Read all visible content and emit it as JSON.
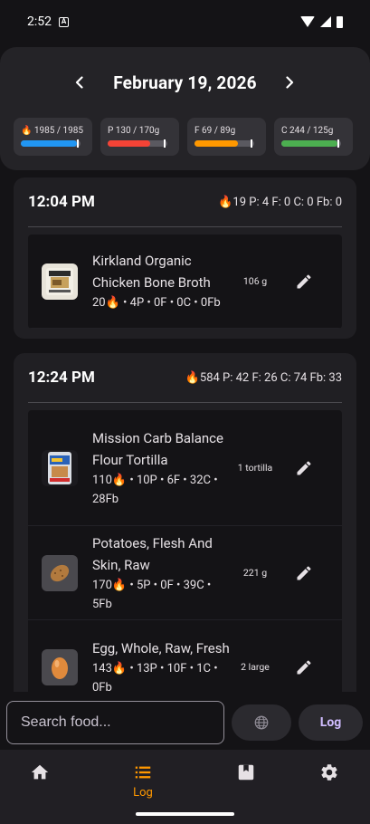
{
  "status_bar": {
    "time": "2:52",
    "notification_icon": "A"
  },
  "header": {
    "date": "February 19, 2026",
    "prev_icon": "chevron-left",
    "next_icon": "chevron-right",
    "macros": [
      {
        "label": "🔥 1985 / 1985",
        "fraction": 1.0,
        "color": "#2196f3"
      },
      {
        "label": "P 130 / 170g",
        "fraction": 0.76,
        "color": "#f44336"
      },
      {
        "label": "F 69 / 89g",
        "fraction": 0.78,
        "color": "#ff9800"
      },
      {
        "label": "C 244 / 125g",
        "fraction": 1.0,
        "color": "#4caf50"
      }
    ]
  },
  "meals": [
    {
      "time": "12:04 PM",
      "summary": "🔥19  P: 4  F: 0  C: 0  Fb: 0",
      "foods": [
        {
          "name": "Kirkland Organic Chicken Bone Broth",
          "macros": "20🔥 • 4P • 0F • 0C • 0Fb",
          "qty": "106 g",
          "icon": "product-photo"
        }
      ]
    },
    {
      "time": "12:24 PM",
      "summary": "🔥584  P: 42  F: 26  C: 74  Fb: 33",
      "foods": [
        {
          "name": "Mission Carb Balance Flour Tortilla",
          "macros": "110🔥 • 10P • 6F • 32C • 28Fb",
          "qty": "1 tortilla",
          "icon": "product-photo"
        },
        {
          "name": "Potatoes, Flesh And Skin, Raw",
          "macros": "170🔥 • 5P • 0F • 39C • 5Fb",
          "qty": "221 g",
          "icon": "potato-emoji"
        },
        {
          "name": "Egg, Whole, Raw, Fresh",
          "macros": "143🔥 • 13P • 10F • 1C • 0Fb",
          "qty": "2 large",
          "icon": "egg-emoji"
        }
      ]
    }
  ],
  "search": {
    "placeholder": "Search food...",
    "log_label": "Log"
  },
  "nav": [
    {
      "label": "",
      "icon": "home",
      "active": false
    },
    {
      "label": "Log",
      "icon": "list",
      "active": true
    },
    {
      "label": "",
      "icon": "book",
      "active": false
    },
    {
      "label": "",
      "icon": "settings",
      "active": false
    }
  ]
}
